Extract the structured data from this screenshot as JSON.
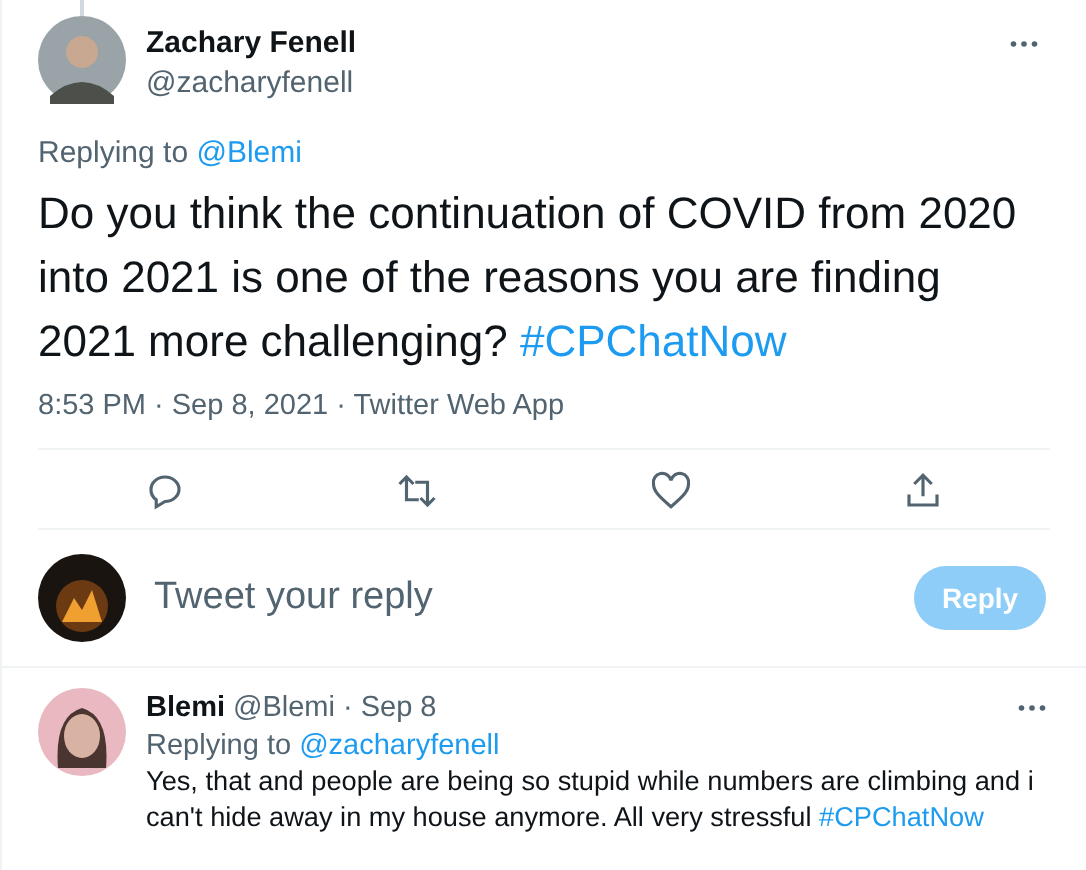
{
  "tweet": {
    "name": "Zachary Fenell",
    "handle": "@zacharyfenell",
    "replying_label": "Replying to",
    "replying_to": "@Blemi",
    "text": "Do you think the continuation of COVID from 2020 into 2021 is one of the reasons you are finding 2021 more challenging?",
    "hashtag": "#CPChatNow",
    "meta": "8:53 PM · Sep 8, 2021 · Twitter Web App"
  },
  "composer": {
    "placeholder": "Tweet your reply",
    "button": {
      "label": "Reply",
      "disabled": true
    }
  },
  "reply": {
    "name": "Blemi",
    "handle": "@Blemi",
    "time": "· Sep 8",
    "replying_label": "Replying to",
    "replying_to": "@zacharyfenell",
    "text": "Yes, that and people are being so stupid while numbers are climbing and i can't hide away in my house anymore. All very stressful",
    "hashtag": "#CPChatNow"
  }
}
